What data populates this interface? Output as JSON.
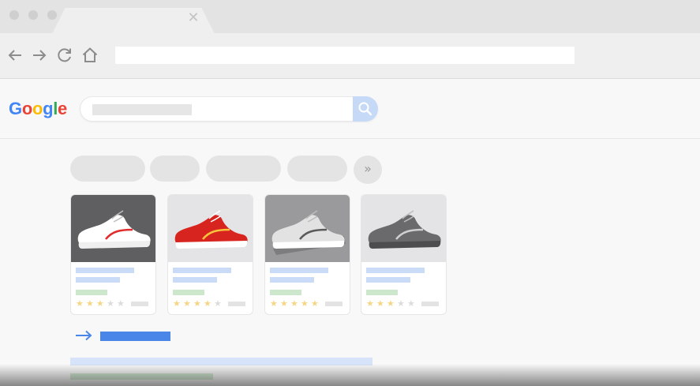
{
  "browser": {
    "window_controls": [
      "close-dot",
      "minimize-dot",
      "maximize-dot"
    ],
    "tab": {
      "close_glyph": "✕"
    },
    "nav": {
      "back_icon": "back-arrow-icon",
      "forward_icon": "forward-arrow-icon",
      "reload_icon": "reload-icon",
      "home_icon": "home-icon"
    },
    "address_bar": {
      "value": ""
    }
  },
  "page": {
    "logo": {
      "letters": [
        "G",
        "o",
        "o",
        "g",
        "l",
        "e"
      ],
      "colors": [
        "#4285f4",
        "#ea4335",
        "#fbbc05",
        "#4285f4",
        "#34a853",
        "#ea4335"
      ]
    },
    "search": {
      "query": "",
      "button_icon": "search-icon"
    },
    "chips": {
      "more_glyph": "»",
      "count": 4
    },
    "products": [
      {
        "image_bg": "#5f5f61",
        "shoe_body": "#ffffff",
        "shoe_accent": "#e02c2c",
        "sole": "#efefef",
        "rating": 3
      },
      {
        "image_bg": "#e4e4e6",
        "shoe_body": "#d8241f",
        "shoe_accent": "#f6c33a",
        "sole": "#ffffff",
        "rating": 4
      },
      {
        "image_bg": "#9a9a9c",
        "shoe_body": "#e2e2e2",
        "shoe_accent": "#5a5a5a",
        "sole": "#ffffff",
        "rating": 5
      },
      {
        "image_bg": "#e4e4e6",
        "shoe_body": "#6a6a6c",
        "shoe_accent": "#cfcfcf",
        "sole": "#4d4d4f",
        "rating": 3
      }
    ],
    "more_results_icon": "right-arrow-icon",
    "colors": {
      "accent_blue": "#4a86e8",
      "placeholder_blue": "#c9dbf7",
      "placeholder_green": "#cde7cd",
      "star": "#f6d586"
    }
  }
}
